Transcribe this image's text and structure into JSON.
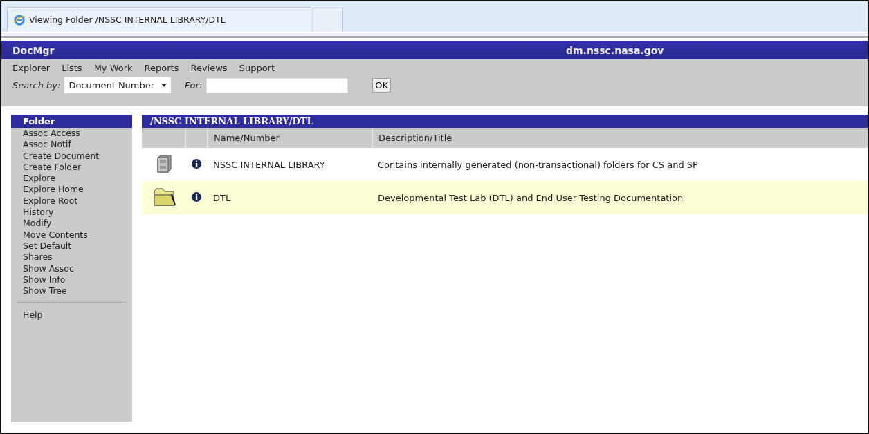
{
  "browser_tab": {
    "title": "Viewing Folder /NSSC INTERNAL LIBRARY/DTL"
  },
  "header": {
    "app_name": "DocMgr",
    "host": "dm.nssc.nasa.gov"
  },
  "menu": [
    "Explorer",
    "Lists",
    "My Work",
    "Reports",
    "Reviews",
    "Support"
  ],
  "search": {
    "label": "Search by:",
    "field": "Document Number",
    "for_label": "For:",
    "ok": "OK"
  },
  "sidebar": {
    "title": "Folder",
    "items": [
      "Assoc Access",
      "Assoc Notif",
      "Create Document",
      "Create Folder",
      "Explore",
      "Explore Home",
      "Explore Root",
      "History",
      "Modify",
      "Move Contents",
      "Set Default",
      "Shares",
      "Show Assoc",
      "Show Info",
      "Show Tree"
    ],
    "footer_items": [
      "Help"
    ]
  },
  "main": {
    "path": "/NSSC INTERNAL LIBRARY/DTL",
    "columns": [
      "Name/Number",
      "Description/Title"
    ],
    "rows": [
      {
        "kind": "cabinet",
        "name": "NSSC INTERNAL LIBRARY",
        "description": "Contains internally generated (non-transactional) folders for CS and SP",
        "selected": false
      },
      {
        "kind": "folder",
        "name": "DTL",
        "description": "Developmental Test Lab (DTL) and End User Testing Documentation",
        "selected": true
      }
    ]
  }
}
